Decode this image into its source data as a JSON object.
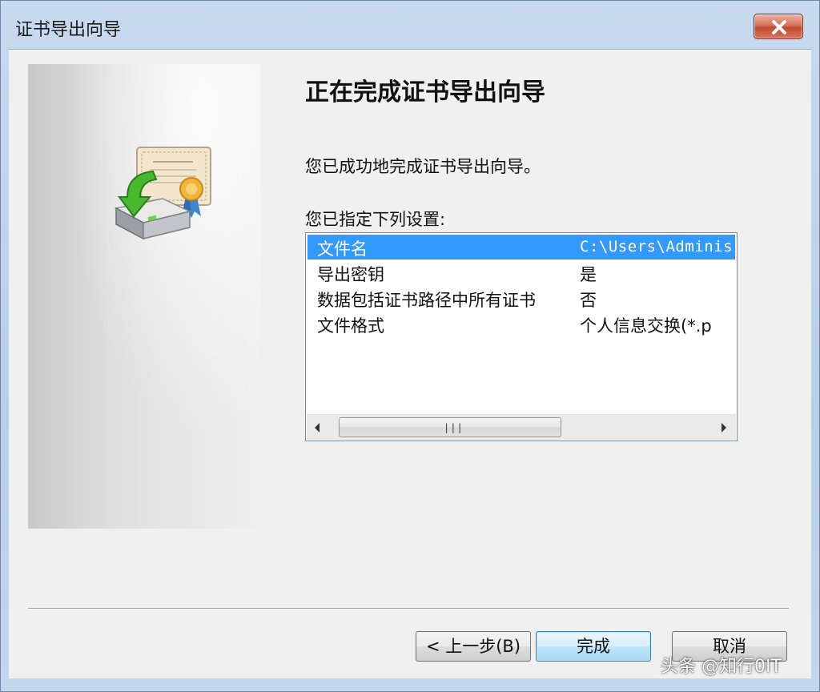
{
  "window": {
    "title": "证书导出向导"
  },
  "wizard": {
    "heading": "正在完成证书导出向导",
    "message": "您已成功地完成证书导出向导。",
    "settings_label": "您已指定下列设置:"
  },
  "settings": {
    "rows": [
      {
        "key": "文件名",
        "value": "C:\\Users\\Adminis"
      },
      {
        "key": "导出密钥",
        "value": "是"
      },
      {
        "key": "数据包括证书路径中所有证书",
        "value": "否"
      },
      {
        "key": "文件格式",
        "value": "个人信息交换(*.p"
      }
    ],
    "selected_index": 0
  },
  "buttons": {
    "back_label": "< 上一步(B)",
    "finish_label": "完成",
    "cancel_label": "取消"
  },
  "watermark": {
    "text": "头条 @知行0IT"
  },
  "icons": {
    "close": "close-icon",
    "cert": "certificate-export-icon",
    "scroll_left": "scroll-left-icon",
    "scroll_right": "scroll-right-icon"
  },
  "colors": {
    "selection": "#3399ff",
    "close_button": "#c9533a",
    "default_button": "#bee6fd"
  }
}
